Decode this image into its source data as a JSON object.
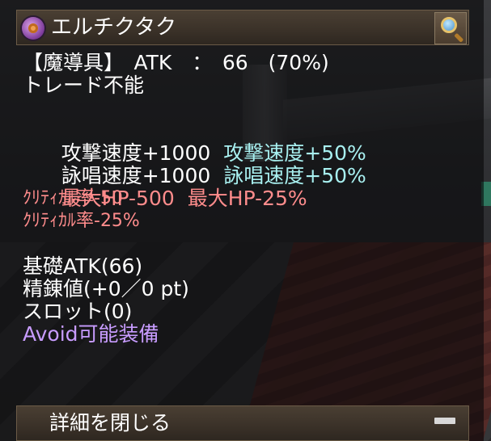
{
  "tooltip": {
    "title": "エルチクタク",
    "icons": {
      "item": "tome-item-icon",
      "search": "magnifier-icon",
      "collapse": "minus-icon"
    },
    "lines": {
      "type_atk": "【魔導具】　ATK　：　66　(70%)",
      "trade": "トレード不能",
      "aspd_flat": "攻撃速度+1000",
      "aspd_pct": "攻撃速度+50%",
      "cspd_flat": "詠唱速度+1000",
      "cspd_pct": "詠唱速度+50%",
      "hp_flat": "最大HP-500",
      "hp_pct": "最大HP-25%",
      "crit_flat": "ｸﾘﾃｨｶﾙ率-50",
      "crit_pct": "ｸﾘﾃｨｶﾙ率-25%",
      "base_atk": "基礎ATK(66)",
      "refine": "精錬値(+0／0 pt)",
      "slot": "スロット(0)",
      "avoid": "Avoid可能装備"
    },
    "footer_label": "詳細を閉じる"
  },
  "colors": {
    "normal": "#ffffff",
    "bonus": "#a8f0f0",
    "penalty": "#ff8c8c",
    "special": "#c89cff"
  }
}
